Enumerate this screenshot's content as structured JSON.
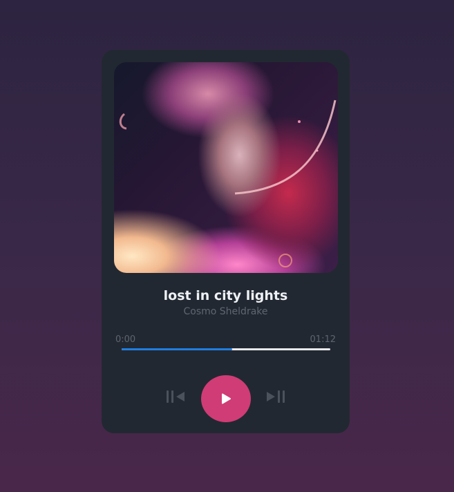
{
  "track": {
    "title": "lost in city lights",
    "artist": "Cosmo Sheldrake",
    "artwork": "album-art-woman-nebula"
  },
  "player": {
    "current_time": "0:00",
    "duration": "01:12",
    "progress_fraction": 0.53
  },
  "controls": {
    "prev_icon": "skip-previous-icon",
    "play_icon": "play-icon",
    "next_icon": "skip-next-icon"
  },
  "colors": {
    "accent": "#d03c75",
    "progress": "#1f7fe0",
    "card": "#222831"
  }
}
